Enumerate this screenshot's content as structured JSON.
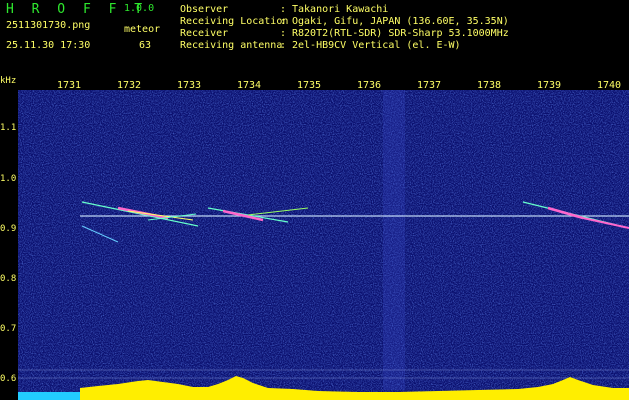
{
  "header": {
    "app_title": "H R O F F T",
    "app_version": "1.0.0",
    "file_name": "2511301730.png",
    "meteor_label": "meteor",
    "timestamp": "25.11.30 17:30",
    "meteor_count": "63"
  },
  "info": {
    "observer_label": "Observer",
    "observer_value": "Takanori Kawachi",
    "location_label": "Receiving Location",
    "location_value": "Ogaki, Gifu, JAPAN (136.60E, 35.35N)",
    "receiver_label": "Receiver",
    "receiver_value": "R820T2(RTL-SDR) SDR-Sharp 53.1000MHz",
    "antenna_label": "Receiving antenna",
    "antenna_value": "2el-HB9CV Vertical (el. E-W)",
    "separator": ":"
  },
  "axis": {
    "unit": "kHz",
    "x_ticks": [
      "1731",
      "1732",
      "1733",
      "1734",
      "1735",
      "1736",
      "1737",
      "1738",
      "1739",
      "1740"
    ],
    "y_ticks": [
      "1.1",
      "1.0",
      "0.9",
      "0.8",
      "0.7",
      "0.6"
    ]
  },
  "colors": {
    "background_noise": "#0a0f6e",
    "trace": "#ff66cc",
    "histogram": "#ffee00",
    "histogram_base": "#22ccff",
    "carrier_line": "#cfe8ff",
    "text_green": "#2ee82e",
    "text_yellow": "#ffff66"
  }
}
